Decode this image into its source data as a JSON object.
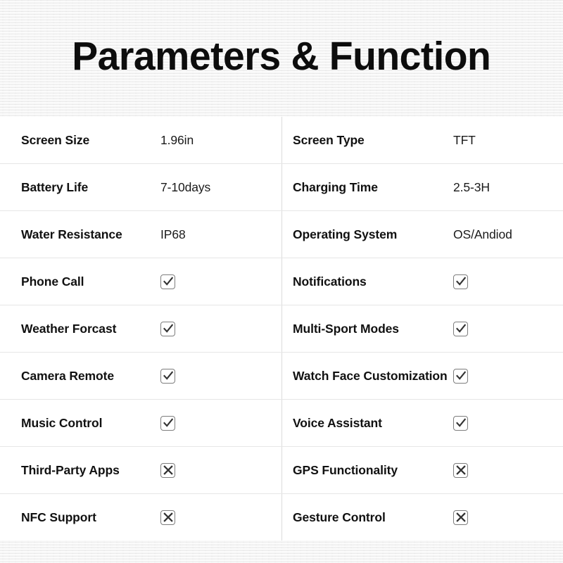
{
  "header": {
    "title": "Parameters & Function"
  },
  "table": {
    "columns": 2,
    "rows": [
      {
        "left": {
          "label": "Screen Size",
          "value": "1.96in",
          "type": "text"
        },
        "right": {
          "label": "Screen Type",
          "value": "TFT",
          "type": "text"
        }
      },
      {
        "left": {
          "label": "Battery Life",
          "value": "7-10days",
          "type": "text"
        },
        "right": {
          "label": "Charging Time",
          "value": "2.5-3H",
          "type": "text"
        }
      },
      {
        "left": {
          "label": "Water Resistance",
          "value": "IP68",
          "type": "text"
        },
        "right": {
          "label": "Operating System",
          "value": "OS/Andiod",
          "type": "text"
        }
      },
      {
        "left": {
          "label": "Phone Call",
          "value": "check",
          "type": "icon"
        },
        "right": {
          "label": "Notifications",
          "value": "check",
          "type": "icon"
        }
      },
      {
        "left": {
          "label": "Weather Forcast",
          "value": "check",
          "type": "icon"
        },
        "right": {
          "label": "Multi-Sport Modes",
          "value": "check",
          "type": "icon"
        }
      },
      {
        "left": {
          "label": "Camera Remote",
          "value": "check",
          "type": "icon"
        },
        "right": {
          "label": "Watch Face Customization",
          "value": "check",
          "type": "icon"
        }
      },
      {
        "left": {
          "label": "Music Control",
          "value": "check",
          "type": "icon"
        },
        "right": {
          "label": "Voice Assistant",
          "value": "check",
          "type": "icon"
        }
      },
      {
        "left": {
          "label": "Third-Party Apps",
          "value": "cross",
          "type": "icon"
        },
        "right": {
          "label": "GPS Functionality",
          "value": "cross",
          "type": "icon"
        }
      },
      {
        "left": {
          "label": "NFC Support",
          "value": "cross",
          "type": "icon"
        },
        "right": {
          "label": "Gesture Control",
          "value": "cross",
          "type": "icon"
        }
      }
    ]
  },
  "icons": {
    "check": "checkbox-checked-icon",
    "cross": "checkbox-crossed-icon"
  },
  "colors": {
    "page_background": "#ffffff",
    "band_background": "#f2f2f2",
    "row_divider": "#e6e6e6",
    "column_divider": "#dcdcdc",
    "label_text": "#111111",
    "value_text": "#1a1a1a",
    "title_text": "#0d0d0d",
    "box_border": "#7d7d7d",
    "box_glyph": "#333333"
  }
}
